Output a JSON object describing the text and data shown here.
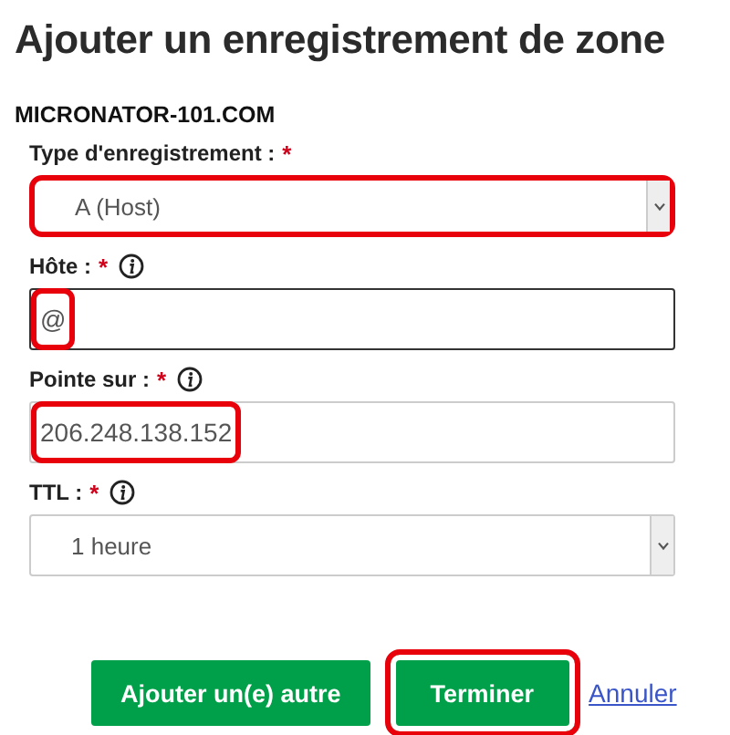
{
  "title": "Ajouter un enregistrement de zone",
  "domain": "MICRONATOR-101.COM",
  "fields": [
    {
      "kind": "select",
      "label": "Type d'enregistrement :",
      "required_mark": "*",
      "value": "A (Host)",
      "control_highlighted": true
    },
    {
      "kind": "text",
      "label": "Hôte :",
      "required_mark": "*",
      "info": true,
      "value": "@",
      "focused": true,
      "value_highlighted": true
    },
    {
      "kind": "text",
      "label": "Pointe sur :",
      "required_mark": "*",
      "info": true,
      "value": "206.248.138.152",
      "focused": false,
      "value_highlighted": true
    },
    {
      "kind": "select",
      "label": "TTL :",
      "required_mark": "*",
      "info": true,
      "value": "1 heure",
      "control_highlighted": false
    }
  ],
  "buttons": [
    {
      "kind": "primary",
      "label": "Ajouter un(e) autre",
      "highlighted": false
    },
    {
      "kind": "primary",
      "label": "Terminer",
      "highlighted": true
    },
    {
      "kind": "link",
      "label": "Annuler",
      "highlighted": false
    }
  ]
}
